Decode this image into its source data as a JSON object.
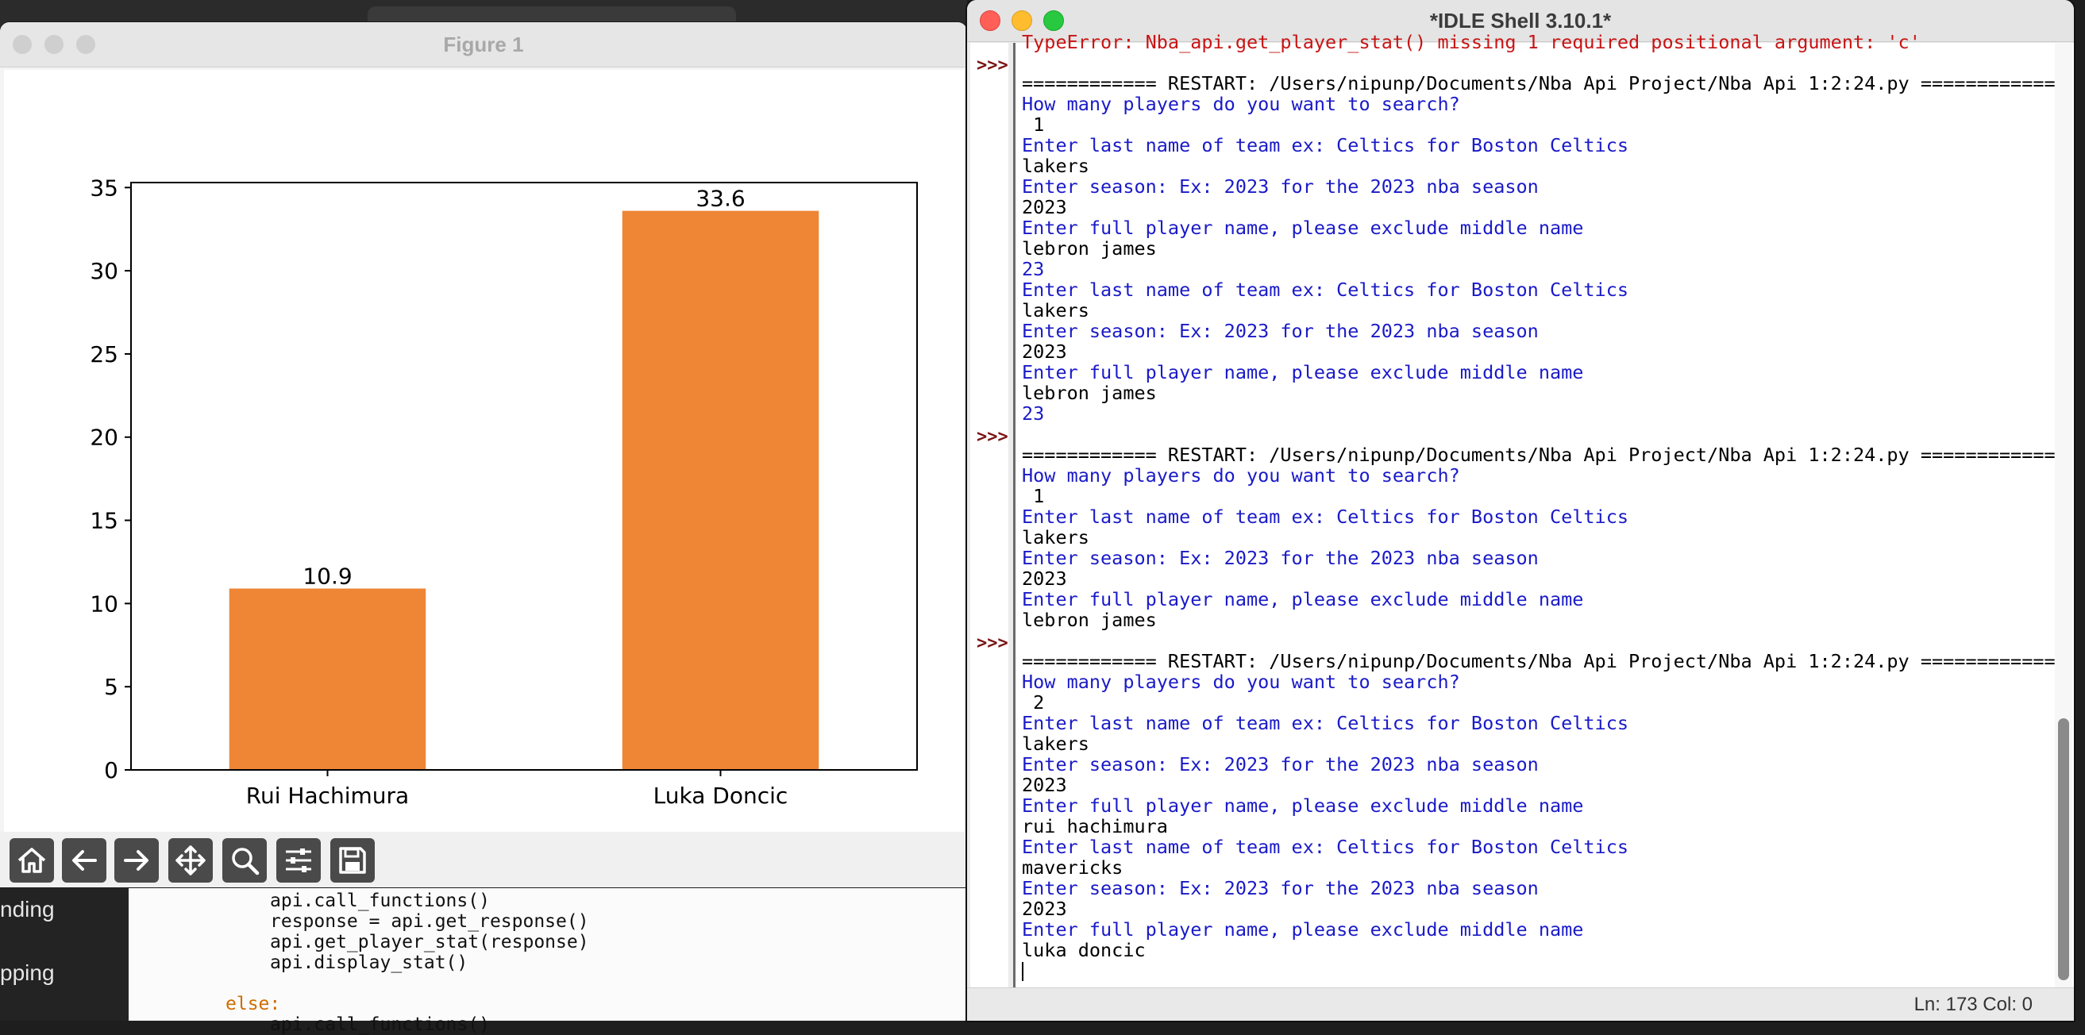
{
  "figure_window": {
    "title": "Figure 1",
    "toolbar": [
      "home-icon",
      "back-arrow-icon",
      "forward-arrow-icon",
      "move-icon",
      "zoom-icon",
      "configure-icon",
      "save-icon"
    ]
  },
  "chart_data": {
    "type": "bar",
    "categories": [
      "Rui Hachimura",
      "Luka Doncic"
    ],
    "values": [
      10.9,
      33.6
    ],
    "data_labels": [
      "10.9",
      "33.6"
    ],
    "yticks": [
      "0",
      "5",
      "10",
      "15",
      "20",
      "25",
      "30",
      "35"
    ],
    "ylim": [
      0,
      35.3
    ],
    "bar_color": "#ef8636",
    "grid": false
  },
  "background": {
    "left_items": [
      "nding",
      "pping"
    ],
    "editor_lines": [
      "api.call_functions()",
      "response = api.get_response()",
      "api.get_player_stat(response)",
      "api.display_stat()",
      "else:",
      "api.call_functions()"
    ]
  },
  "idle": {
    "title": "*IDLE Shell 3.10.1*",
    "status": "Ln: 173  Col: 0",
    "gutter_prompts": [
      ">>>",
      ">>>",
      ">>>"
    ],
    "lines": [
      {
        "kind": "err",
        "text": "TypeError: Nba_api.get_player_stat() missing 1 required positional argument: 'c'"
      },
      {
        "kind": "out",
        "text": ""
      },
      {
        "kind": "out",
        "text": "============ RESTART: /Users/nipunp/Documents/Nba Api Project/Nba Api 1:2:24.py ============"
      },
      {
        "kind": "prompt",
        "text": "How many players do you want to search?"
      },
      {
        "kind": "out",
        "text": " 1"
      },
      {
        "kind": "prompt",
        "text": "Enter last name of team ex: Celtics for Boston Celtics"
      },
      {
        "kind": "out",
        "text": "lakers"
      },
      {
        "kind": "prompt",
        "text": "Enter season: Ex: 2023 for the 2023 nba season"
      },
      {
        "kind": "out",
        "text": "2023"
      },
      {
        "kind": "prompt",
        "text": "Enter full player name, please exclude middle name"
      },
      {
        "kind": "out",
        "text": "lebron james"
      },
      {
        "kind": "prompt",
        "text": "23"
      },
      {
        "kind": "prompt",
        "text": "Enter last name of team ex: Celtics for Boston Celtics"
      },
      {
        "kind": "out",
        "text": "lakers"
      },
      {
        "kind": "prompt",
        "text": "Enter season: Ex: 2023 for the 2023 nba season"
      },
      {
        "kind": "out",
        "text": "2023"
      },
      {
        "kind": "prompt",
        "text": "Enter full player name, please exclude middle name"
      },
      {
        "kind": "out",
        "text": "lebron james"
      },
      {
        "kind": "prompt",
        "text": "23"
      },
      {
        "kind": "out",
        "text": ""
      },
      {
        "kind": "out",
        "text": "============ RESTART: /Users/nipunp/Documents/Nba Api Project/Nba Api 1:2:24.py ============"
      },
      {
        "kind": "prompt",
        "text": "How many players do you want to search?"
      },
      {
        "kind": "out",
        "text": " 1"
      },
      {
        "kind": "prompt",
        "text": "Enter last name of team ex: Celtics for Boston Celtics"
      },
      {
        "kind": "out",
        "text": "lakers"
      },
      {
        "kind": "prompt",
        "text": "Enter season: Ex: 2023 for the 2023 nba season"
      },
      {
        "kind": "out",
        "text": "2023"
      },
      {
        "kind": "prompt",
        "text": "Enter full player name, please exclude middle name"
      },
      {
        "kind": "out",
        "text": "lebron james"
      },
      {
        "kind": "out",
        "text": ""
      },
      {
        "kind": "out",
        "text": "============ RESTART: /Users/nipunp/Documents/Nba Api Project/Nba Api 1:2:24.py ============"
      },
      {
        "kind": "prompt",
        "text": "How many players do you want to search?"
      },
      {
        "kind": "out",
        "text": " 2"
      },
      {
        "kind": "prompt",
        "text": "Enter last name of team ex: Celtics for Boston Celtics"
      },
      {
        "kind": "out",
        "text": "lakers"
      },
      {
        "kind": "prompt",
        "text": "Enter season: Ex: 2023 for the 2023 nba season"
      },
      {
        "kind": "out",
        "text": "2023"
      },
      {
        "kind": "prompt",
        "text": "Enter full player name, please exclude middle name"
      },
      {
        "kind": "out",
        "text": "rui hachimura"
      },
      {
        "kind": "prompt",
        "text": "Enter last name of team ex: Celtics for Boston Celtics"
      },
      {
        "kind": "out",
        "text": "mavericks"
      },
      {
        "kind": "prompt",
        "text": "Enter season: Ex: 2023 for the 2023 nba season"
      },
      {
        "kind": "out",
        "text": "2023"
      },
      {
        "kind": "prompt",
        "text": "Enter full player name, please exclude middle name"
      },
      {
        "kind": "out",
        "text": "luka doncic"
      }
    ]
  }
}
